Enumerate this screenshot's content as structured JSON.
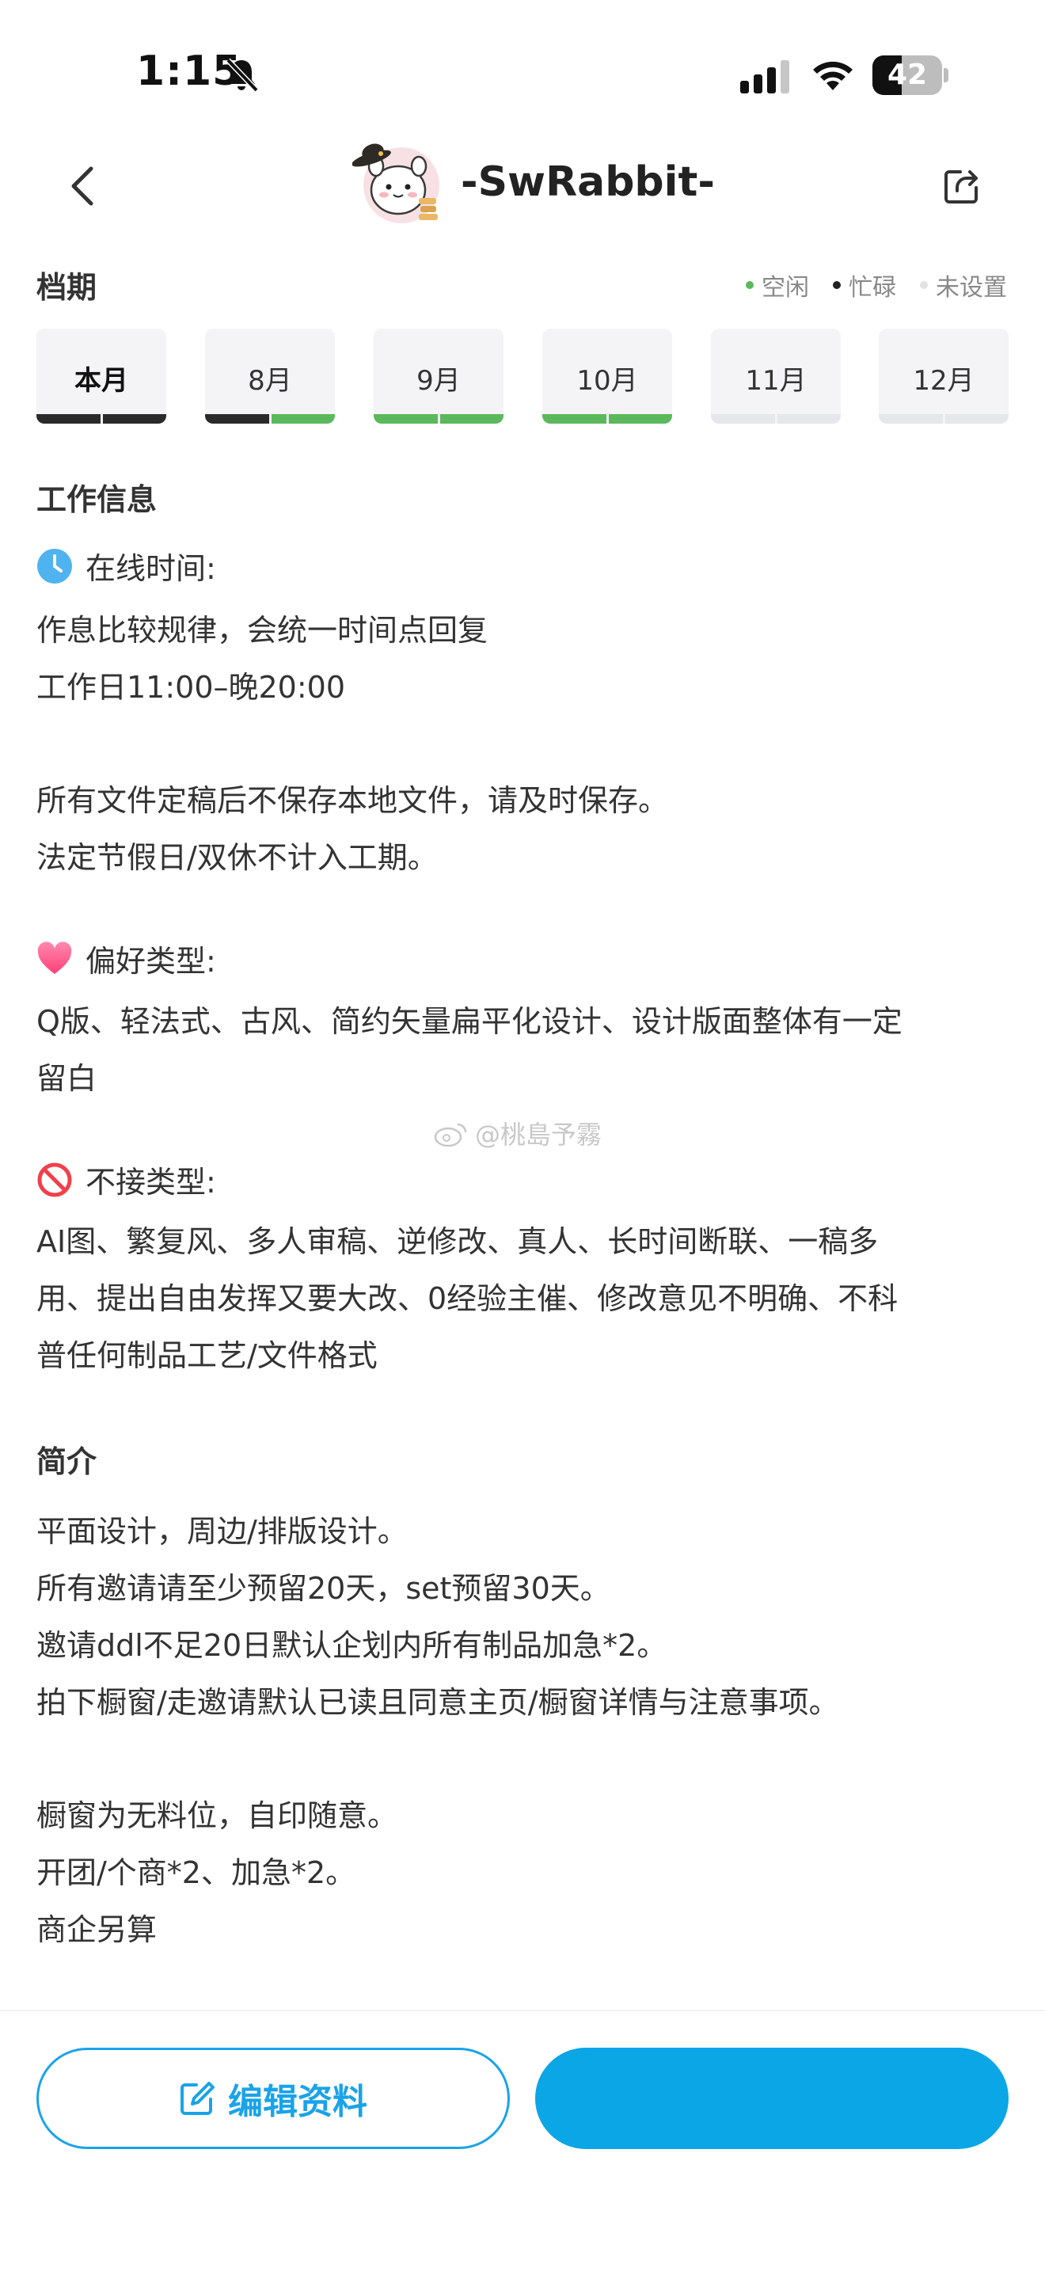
{
  "status_bar": {
    "time": "1:15",
    "battery": "42",
    "battery_fraction": 0.42
  },
  "nav": {
    "title": "-SwRabbit-",
    "back_icon": "chevron-left-icon",
    "share_icon": "share-icon"
  },
  "schedule": {
    "title": "档期",
    "legend": [
      {
        "label": "空闲",
        "color": "#5cb85c"
      },
      {
        "label": "忙碌",
        "color": "#222222"
      },
      {
        "label": "未设置",
        "color": "#e2e2e2"
      }
    ],
    "months": [
      {
        "label": "本月",
        "current": true,
        "status": [
          "busy",
          "busy"
        ]
      },
      {
        "label": "8月",
        "current": false,
        "status": [
          "busy",
          "free"
        ]
      },
      {
        "label": "9月",
        "current": false,
        "status": [
          "free",
          "free"
        ]
      },
      {
        "label": "10月",
        "current": false,
        "status": [
          "free",
          "free"
        ]
      },
      {
        "label": "11月",
        "current": false,
        "status": [
          "unset",
          "unset"
        ]
      },
      {
        "label": "12月",
        "current": false,
        "status": [
          "unset",
          "unset"
        ]
      }
    ],
    "colors": {
      "busy": "#2a2a2a",
      "free": "#5cb85c",
      "unset": "#e6e7ea"
    }
  },
  "work_info": {
    "title": "工作信息",
    "online_label": "在线时间:",
    "online_lines": [
      "作息比较规律，会统一时间点回复",
      "工作日11:00–晚20:00"
    ],
    "file_lines": [
      "所有文件定稿后不保存本地文件，请及时保存。",
      "法定节假日/双休不计入工期。"
    ],
    "prefer_label": "偏好类型:",
    "prefer_lines": [
      "Q版、轻法式、古风、简约矢量扁平化设计、设计版面整体有一定",
      "留白"
    ],
    "reject_label": "不接类型:",
    "reject_lines": [
      "AI图、繁复风、多人审稿、逆修改、真人、长时间断联、一稿多",
      "用、提出自由发挥又要大改、0经验主催、修改意见不明确、不科",
      "普任何制品工艺/文件格式"
    ]
  },
  "watermark": "@桃島予霧",
  "intro": {
    "title": "简介",
    "lines_a": [
      "平面设计，周边/排版设计。",
      "所有邀请请至少预留20天，set预留30天。",
      "邀请ddl不足20日默认企划内所有制品加急*2。",
      "拍下橱窗/走邀请默认已读且同意主页/橱窗详情与注意事项。"
    ],
    "lines_b": [
      "橱窗为无料位，自印随意。",
      "开团/个商*2、加急*2。",
      "商企另算"
    ]
  },
  "actions": {
    "edit_label": "编辑资料",
    "accent": "#1aa3e8"
  }
}
